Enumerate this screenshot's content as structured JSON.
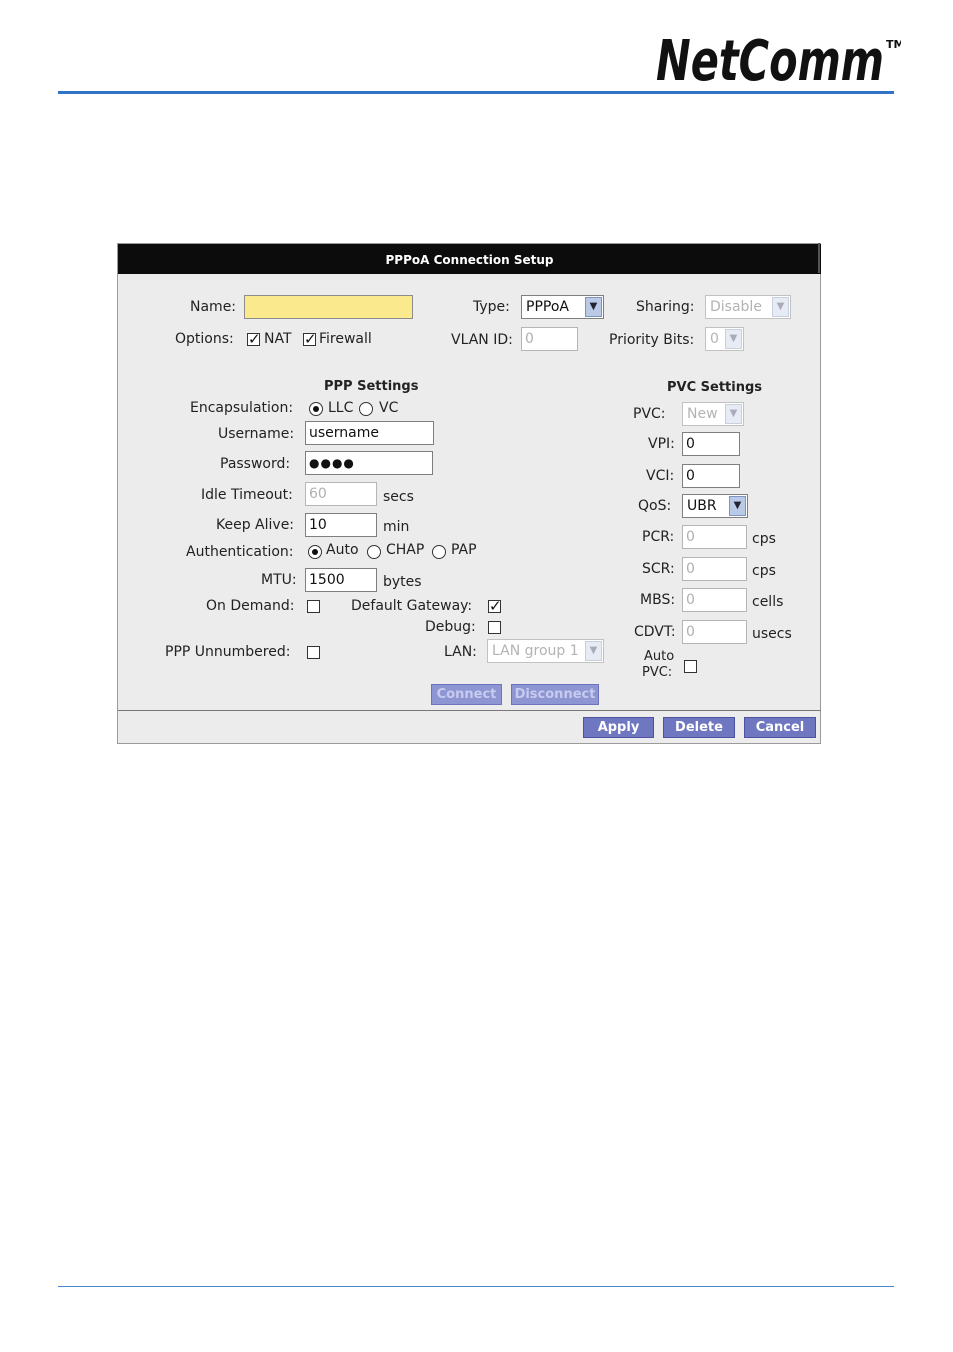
{
  "brand": {
    "logo_text": "NetComm",
    "trademark": "TM",
    "accent_color": "#2f74c9"
  },
  "panel": {
    "title": "PPPoA Connection Setup"
  },
  "top": {
    "name_label": "Name:",
    "name_value": "",
    "type_label": "Type:",
    "type_value": "PPPoA",
    "sharing_label": "Sharing:",
    "sharing_value": "Disable",
    "options_label": "Options:",
    "nat_label": "NAT",
    "nat_checked": true,
    "firewall_label": "Firewall",
    "firewall_checked": true,
    "vlan_label": "VLAN ID:",
    "vlan_value": "0",
    "priority_label": "Priority Bits:",
    "priority_value": "0"
  },
  "ppp": {
    "header": "PPP Settings",
    "encapsulation_label": "Encapsulation:",
    "llc_label": "LLC",
    "vc_label": "VC",
    "encapsulation_selected": "LLC",
    "username_label": "Username:",
    "username_value": "username",
    "password_label": "Password:",
    "password_value": "●●●●",
    "idle_label": "Idle Timeout:",
    "idle_value": "60",
    "idle_unit": "secs",
    "keepalive_label": "Keep Alive:",
    "keepalive_value": "10",
    "keepalive_unit": "min",
    "auth_label": "Authentication:",
    "auth_auto": "Auto",
    "auth_chap": "CHAP",
    "auth_pap": "PAP",
    "auth_selected": "Auto",
    "mtu_label": "MTU:",
    "mtu_value": "1500",
    "mtu_unit": "bytes",
    "ondemand_label": "On Demand:",
    "ondemand_checked": false,
    "defaultgw_label": "Default Gateway:",
    "defaultgw_checked": true,
    "debug_label": "Debug:",
    "debug_checked": false,
    "unnumbered_label": "PPP Unnumbered:",
    "unnumbered_checked": false,
    "lan_label": "LAN:",
    "lan_value": "LAN group 1"
  },
  "pvc": {
    "header": "PVC Settings",
    "pvc_label": "PVC:",
    "pvc_value": "New",
    "vpi_label": "VPI:",
    "vpi_value": "0",
    "vci_label": "VCI:",
    "vci_value": "0",
    "qos_label": "QoS:",
    "qos_value": "UBR",
    "pcr_label": "PCR:",
    "pcr_value": "0",
    "pcr_unit": "cps",
    "scr_label": "SCR:",
    "scr_value": "0",
    "scr_unit": "cps",
    "mbs_label": "MBS:",
    "mbs_value": "0",
    "mbs_unit": "cells",
    "cdvt_label": "CDVT:",
    "cdvt_value": "0",
    "cdvt_unit": "usecs",
    "auto_label_1": "Auto",
    "auto_label_2": "PVC:",
    "auto_checked": false
  },
  "buttons": {
    "connect": "Connect",
    "disconnect": "Disconnect",
    "apply": "Apply",
    "delete": "Delete",
    "cancel": "Cancel"
  }
}
